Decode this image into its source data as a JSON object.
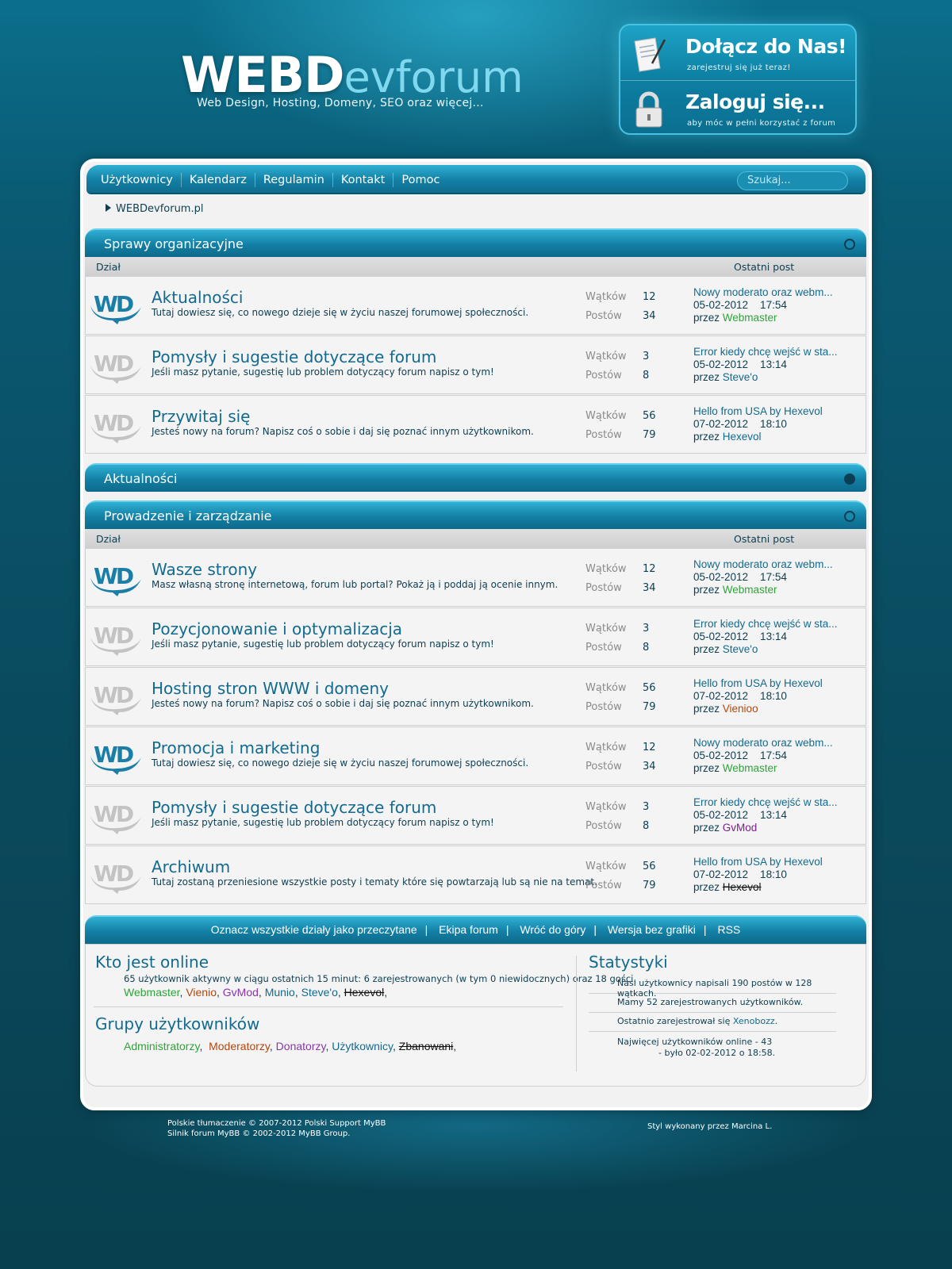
{
  "header": {
    "logo_main": "WEBD",
    "logo_sub": "evforum",
    "tagline": "Web Design, Hosting, Domeny, SEO oraz więcej...",
    "join_title": "Dołącz do Nas!",
    "join_sub": "zarejestruj się już teraz!",
    "login_title": "Zaloguj się...",
    "login_sub": "aby móc w pełni korzystać z forum"
  },
  "nav": {
    "items": [
      "Użytkownicy",
      "Kalendarz",
      "Regulamin",
      "Kontakt",
      "Pomoc"
    ],
    "search_placeholder": "Szukaj..."
  },
  "breadcrumb": "WEBDevforum.pl",
  "columns": {
    "section": "Dział",
    "last_post": "Ostatni post"
  },
  "labels": {
    "threads": "Wątków",
    "posts": "Postów",
    "by": "przez"
  },
  "categories": [
    {
      "title": "Sprawy organizacyjne",
      "forums": [
        {
          "name": "Aktualności",
          "desc": "Tutaj dowiesz się, co nowego dzieje się w życiu naszej forumowej społeczności.",
          "threads": "12",
          "posts": "34",
          "lp_title": "Nowy moderato oraz webm...",
          "lp_date": "05-02-2012    17:54",
          "lp_user": "Webmaster",
          "active": true
        },
        {
          "name": "Pomysły i sugestie dotyczące forum",
          "desc": "Jeśli masz pytanie, sugestię lub problem dotyczący forum napisz o tym!",
          "threads": "3",
          "posts": "8",
          "lp_title": "Error kiedy chcę wejść w sta...",
          "lp_date": "05-02-2012    13:14",
          "lp_user": "Steve'o",
          "active": false
        },
        {
          "name": "Przywitaj się",
          "desc": "Jesteś nowy na forum? Napisz coś o sobie i daj się poznać innym użytkownikom.",
          "threads": "56",
          "posts": "79",
          "lp_title": "Hello from USA by Hexevol",
          "lp_date": "07-02-2012    18:10",
          "lp_user": "Hexevol",
          "active": false
        }
      ]
    },
    {
      "title": "Aktualności"
    },
    {
      "title": "Prowadzenie i zarządzanie",
      "forums": [
        {
          "name": "Wasze strony",
          "desc": "Masz własną stronę internetową, forum lub portal? Pokaż ją i poddaj ją ocenie innym.",
          "threads": "12",
          "posts": "34",
          "lp_title": "Nowy moderato oraz webm...",
          "lp_date": "05-02-2012    17:54",
          "lp_user": "Webmaster",
          "active": true
        },
        {
          "name": "Pozycjonowanie i optymalizacja",
          "desc": "Jeśli masz pytanie, sugestię lub problem dotyczący forum napisz o tym!",
          "threads": "3",
          "posts": "8",
          "lp_title": "Error kiedy chcę wejść w sta...",
          "lp_date": "05-02-2012    13:14",
          "lp_user": "Steve'o",
          "active": false
        },
        {
          "name": "Hosting stron WWW i domeny",
          "desc": "Jesteś nowy na forum? Napisz coś o sobie i daj się poznać innym użytkownikom.",
          "threads": "56",
          "posts": "79",
          "lp_title": "Hello from USA by Hexevol",
          "lp_date": "07-02-2012    18:10",
          "lp_user": "Vienioo",
          "active": false
        },
        {
          "name": "Promocja i marketing",
          "desc": "Tutaj dowiesz się, co nowego dzieje się w życiu naszej forumowej społeczności.",
          "threads": "12",
          "posts": "34",
          "lp_title": "Nowy moderato oraz webm...",
          "lp_date": "05-02-2012    17:54",
          "lp_user": "Webmaster",
          "active": true
        },
        {
          "name": "Pomysły i sugestie dotyczące forum",
          "desc": "Jeśli masz pytanie, sugestię lub problem dotyczący forum napisz o tym!",
          "threads": "3",
          "posts": "8",
          "lp_title": "Error kiedy chcę wejść w sta...",
          "lp_date": "05-02-2012    13:14",
          "lp_user": "GvMod",
          "active": false
        },
        {
          "name": "Archiwum",
          "desc": "Tutaj zostaną przeniesione wszystkie posty i tematy które się powtarzają lub są nie na temat.",
          "threads": "56",
          "posts": "79",
          "lp_title": "Hello from USA by Hexevol",
          "lp_date": "07-02-2012    18:10",
          "lp_user": "Hexevol",
          "active": false
        }
      ]
    }
  ],
  "footer_links": [
    "Oznacz wszystkie działy jako przeczytane",
    "Ekipa forum",
    "Wróć do góry",
    "Wersja bez grafiki",
    "RSS"
  ],
  "online": {
    "title": "Kto jest online",
    "summary": "65 użytkownik aktywny w ciągu ostatnich 15 minut: 6 zarejestrowanych (w tym 0 niewidocznych) oraz 18 gości.",
    "users": [
      "Webmaster",
      "Vienio",
      "GvMod",
      "Munio",
      "Steve'o",
      "Hexevol"
    ]
  },
  "groups": {
    "title": "Grupy użytkowników",
    "items": [
      "Administratorzy",
      "Moderatorzy",
      "Donatorzy",
      "Użytkownicy",
      "Zbanowani"
    ]
  },
  "stats": {
    "title": "Statystyki",
    "line1": "Nasi użytkownicy napisali 190 postów w 128 wątkach.",
    "line2": "Mamy 52 zarejestrowanych użytkowników.",
    "line3_prefix": "Ostatnio zarejestrował się ",
    "line3_user": "Xenobozz",
    "line4a": "Najwięcej użytkowników online - 43",
    "line4b": "- było 02-02-2012 o 18:58."
  },
  "page_footer": {
    "line1": "Polskie tłumaczenie © 2007-2012 Polski Support MyBB",
    "line2": "Silnik forum MyBB © 2002-2012 MyBB Group.",
    "style_credit": "Styl wykonany przez Marcina L."
  },
  "colors": {
    "accent": "#136a8f",
    "admin": "#2fa33a",
    "moderator": "#b4460c",
    "donator": "#8a36a8"
  }
}
